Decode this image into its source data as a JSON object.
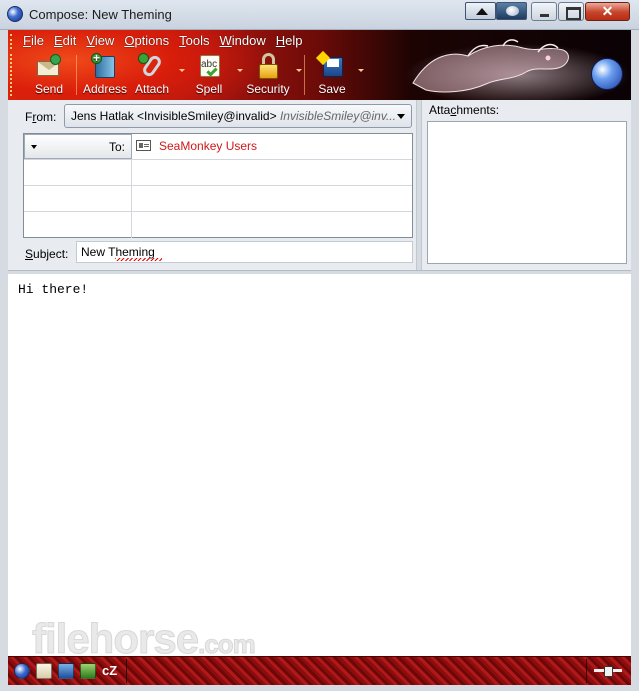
{
  "window": {
    "title": "Compose: New Theming"
  },
  "menubar": {
    "items": [
      {
        "mnemonic": "F",
        "rest": "ile"
      },
      {
        "mnemonic": "E",
        "rest": "dit"
      },
      {
        "mnemonic": "V",
        "rest": "iew"
      },
      {
        "mnemonic": "O",
        "rest": "ptions"
      },
      {
        "mnemonic": "T",
        "rest": "ools"
      },
      {
        "mnemonic": "W",
        "rest": "indow"
      },
      {
        "mnemonic": "H",
        "rest": "elp"
      }
    ]
  },
  "toolbar": {
    "send_label": "Send",
    "address_label": "Address",
    "attach_label": "Attach",
    "spell_label": "Spell",
    "security_label": "Security",
    "save_label": "Save",
    "icons": {
      "send": "send-envelope-icon",
      "address": "address-book-icon",
      "attach": "paperclip-icon",
      "spell": "spellcheck-icon",
      "security": "padlock-icon",
      "save": "save-disk-icon"
    }
  },
  "header": {
    "from_label_mnemonic": "r",
    "from_label_pre": "F",
    "from_label_post": "om:",
    "from_identity": "Jens Hatlak <InvisibleSmiley@invalid>",
    "from_identity_detail": "InvisibleSmiley@inv...",
    "address_type": "To:",
    "address_value": "SeaMonkey Users",
    "address_value_color": "#d01818",
    "subject_label_mnemonic": "S",
    "subject_label_rest": "ubject:",
    "subject_value": "New Theming",
    "attachments_label_pre": "Atta",
    "attachments_label_mnemonic": "c",
    "attachments_label_post": "hments:"
  },
  "body": {
    "text": "Hi there!"
  },
  "watermark": {
    "text": "filehorse",
    "tld": ".com"
  },
  "statusbar": {
    "irc_label": "cZ",
    "components": [
      "navigator-icon",
      "mail-icon",
      "composer-icon",
      "address-book-icon",
      "chatzilla-icon"
    ]
  },
  "theme": {
    "accent_red": "#b1150f",
    "text_on_toolbar": "#ffffff"
  }
}
